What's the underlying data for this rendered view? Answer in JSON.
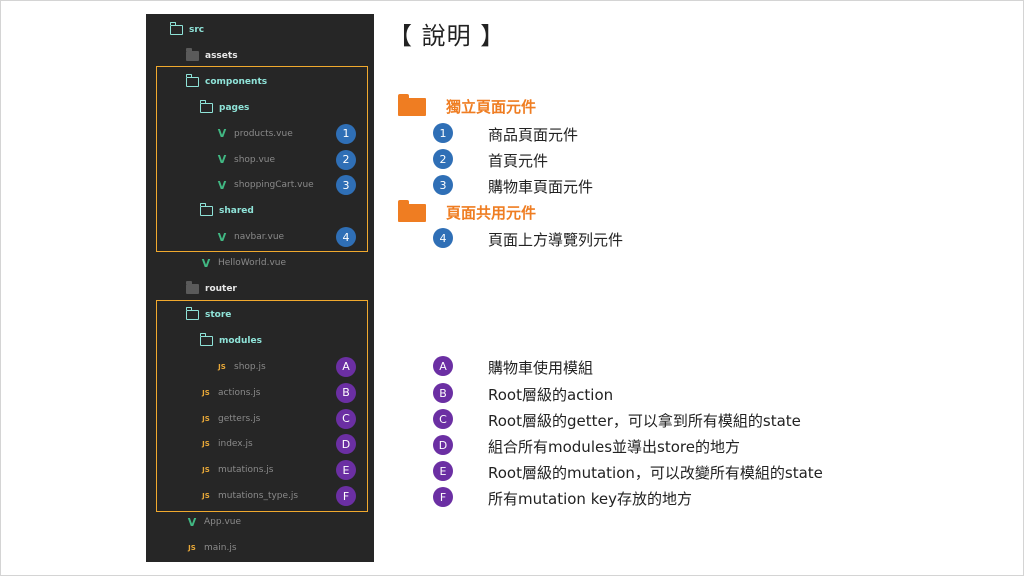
{
  "tree": {
    "rows": [
      {
        "label": "src",
        "kind": "folder-open",
        "level": 0
      },
      {
        "label": "assets",
        "kind": "folder-closed",
        "level": 1
      },
      {
        "label": "components",
        "kind": "folder-open",
        "level": 1
      },
      {
        "label": "pages",
        "kind": "folder-open",
        "level": 2
      },
      {
        "label": "products.vue",
        "kind": "vue",
        "level": 3
      },
      {
        "label": "shop.vue",
        "kind": "vue",
        "level": 3
      },
      {
        "label": "shoppingCart.vue",
        "kind": "vue",
        "level": 3
      },
      {
        "label": "shared",
        "kind": "folder-open",
        "level": 2
      },
      {
        "label": "navbar.vue",
        "kind": "vue",
        "level": 3
      },
      {
        "label": "HelloWorld.vue",
        "kind": "vue",
        "level": 2
      },
      {
        "label": "router",
        "kind": "folder-closed",
        "level": 1
      },
      {
        "label": "store",
        "kind": "folder-open",
        "level": 1
      },
      {
        "label": "modules",
        "kind": "folder-open",
        "level": 2
      },
      {
        "label": "shop.js",
        "kind": "js",
        "level": 3
      },
      {
        "label": "actions.js",
        "kind": "js",
        "level": 2
      },
      {
        "label": "getters.js",
        "kind": "js",
        "level": 2
      },
      {
        "label": "index.js",
        "kind": "js",
        "level": 2
      },
      {
        "label": "mutations.js",
        "kind": "js",
        "level": 2
      },
      {
        "label": "mutations_type.js",
        "kind": "js",
        "level": 2
      },
      {
        "label": "App.vue",
        "kind": "vue",
        "level": 1
      },
      {
        "label": "main.js",
        "kind": "js",
        "level": 1
      }
    ],
    "vue_icon": "V",
    "js_icon": "JS",
    "tree_badges": [
      {
        "text": "1",
        "row": 4,
        "color": "blue"
      },
      {
        "text": "2",
        "row": 5,
        "color": "blue"
      },
      {
        "text": "3",
        "row": 6,
        "color": "blue"
      },
      {
        "text": "4",
        "row": 8,
        "color": "blue"
      },
      {
        "text": "A",
        "row": 13,
        "color": "purple"
      },
      {
        "text": "B",
        "row": 14,
        "color": "purple"
      },
      {
        "text": "C",
        "row": 15,
        "color": "purple"
      },
      {
        "text": "D",
        "row": 16,
        "color": "purple"
      },
      {
        "text": "E",
        "row": 17,
        "color": "purple"
      },
      {
        "text": "F",
        "row": 18,
        "color": "purple"
      }
    ]
  },
  "explain": {
    "title": "【 說明 】",
    "section1": "獨立頁面元件",
    "section2": "頁面共用元件",
    "items": [
      {
        "badge": "1",
        "text": "商品頁面元件",
        "color": "blue"
      },
      {
        "badge": "2",
        "text": "首頁元件",
        "color": "blue"
      },
      {
        "badge": "3",
        "text": "購物車頁面元件",
        "color": "blue"
      },
      {
        "badge": "4",
        "text": "頁面上方導覽列元件",
        "color": "blue"
      },
      {
        "badge": "A",
        "text": "購物車使用模組",
        "color": "purple"
      },
      {
        "badge": "B",
        "text": "Root層級的action",
        "color": "purple"
      },
      {
        "badge": "C",
        "text": "Root層級的getter，可以拿到所有模組的state",
        "color": "purple"
      },
      {
        "badge": "D",
        "text": "組合所有modules並導出store的地方",
        "color": "purple"
      },
      {
        "badge": "E",
        "text": "Root層級的mutation，可以改變所有模組的state",
        "color": "purple"
      },
      {
        "badge": "F",
        "text": "所有mutation key存放的地方",
        "color": "purple"
      }
    ]
  },
  "colors": {
    "panel_bg": "#262626",
    "folder_open": "#8fe3d8",
    "vue_green": "#41b883",
    "js_yellow": "#e8a838",
    "highlight": "#f0a92e",
    "badge_blue": "#2f6fb6",
    "badge_purple": "#6b2fa3",
    "section_orange": "#ef7d22"
  }
}
